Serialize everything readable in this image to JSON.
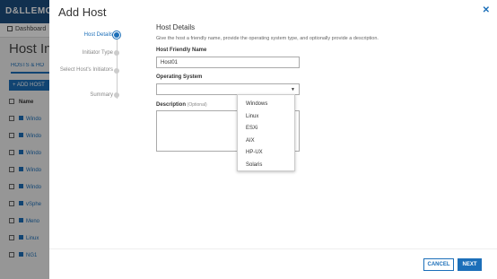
{
  "app": {
    "brand": "D&LLEMC",
    "nav": {
      "dashboard": "Dashboard"
    },
    "page_title": "Host Info",
    "tab_label": "HOSTS & HO",
    "add_button": "+ ADD HOST",
    "table_header": "Name",
    "rows": [
      "Windo",
      "Windo",
      "Windo",
      "Windo",
      "Windo",
      "vSphe",
      "Meno",
      "Linux",
      "NG1"
    ]
  },
  "modal": {
    "title": "Add Host",
    "close": "✕",
    "steps": [
      {
        "label": "Host Details"
      },
      {
        "label": "Initiator Type"
      },
      {
        "label": "Select Host's Initiators"
      },
      {
        "label": "Summary"
      }
    ],
    "section_title": "Host Details",
    "section_desc": "Give the host a friendly name, provide the operating system type, and optionally provide a description.",
    "host_name_label": "Host Friendly Name",
    "host_name_value": "Host01",
    "os_label": "Operating System",
    "os_value": "",
    "description_label": "Description",
    "description_optional": "(Optional)",
    "os_options": [
      "Windows",
      "Linux",
      "ESXi",
      "AIX",
      "HP-UX",
      "Solaris"
    ],
    "cancel_label": "CANCEL",
    "next_label": "NEXT"
  },
  "colors": {
    "accent": "#1c6fb9",
    "brand_bar": "#1c4e80"
  }
}
